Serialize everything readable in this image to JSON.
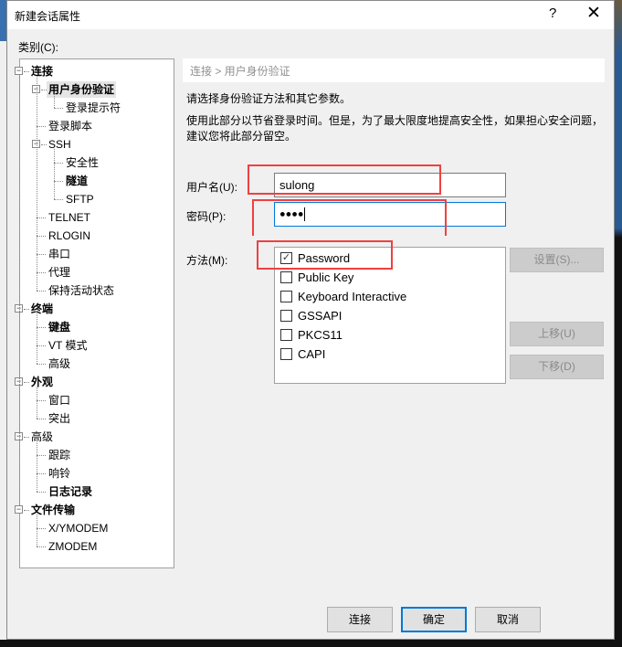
{
  "window": {
    "title": "新建会话属性",
    "help": "?",
    "close": "✕"
  },
  "category_label": "类别(C):",
  "tree": [
    {
      "label": "连接",
      "level": 0,
      "bold": true,
      "toggle": "−"
    },
    {
      "label": "用户身份验证",
      "level": 1,
      "bold": true,
      "selected": true,
      "toggle": "−"
    },
    {
      "label": "登录提示符",
      "level": 2
    },
    {
      "label": "登录脚本",
      "level": 1
    },
    {
      "label": "SSH",
      "level": 1,
      "toggle": "−"
    },
    {
      "label": "安全性",
      "level": 2
    },
    {
      "label": "隧道",
      "level": 2,
      "bold": true
    },
    {
      "label": "SFTP",
      "level": 2
    },
    {
      "label": "TELNET",
      "level": 1
    },
    {
      "label": "RLOGIN",
      "level": 1
    },
    {
      "label": "串口",
      "level": 1
    },
    {
      "label": "代理",
      "level": 1
    },
    {
      "label": "保持活动状态",
      "level": 1
    },
    {
      "label": "终端",
      "level": 0,
      "bold": true,
      "toggle": "−"
    },
    {
      "label": "键盘",
      "level": 1,
      "bold": true
    },
    {
      "label": "VT 模式",
      "level": 1
    },
    {
      "label": "高级",
      "level": 1
    },
    {
      "label": "外观",
      "level": 0,
      "bold": true,
      "toggle": "−"
    },
    {
      "label": "窗口",
      "level": 1
    },
    {
      "label": "突出",
      "level": 1
    },
    {
      "label": "高级",
      "level": 0,
      "toggle": "−"
    },
    {
      "label": "跟踪",
      "level": 1
    },
    {
      "label": "响铃",
      "level": 1
    },
    {
      "label": "日志记录",
      "level": 1,
      "bold": true
    },
    {
      "label": "文件传输",
      "level": 0,
      "bold": true,
      "toggle": "−"
    },
    {
      "label": "X/YMODEM",
      "level": 1
    },
    {
      "label": "ZMODEM",
      "level": 1
    }
  ],
  "breadcrumb": "连接 > 用户身份验证",
  "desc1": "请选择身份验证方法和其它参数。",
  "desc2": "使用此部分以节省登录时间。但是，为了最大限度地提高安全性，如果担心安全问题，",
  "desc3": "建议您将此部分留空。",
  "username": {
    "label": "用户名(U):",
    "value": "sulong"
  },
  "password": {
    "label": "密码(P):",
    "value": "●●●●"
  },
  "method": {
    "label": "方法(M):",
    "options": [
      {
        "label": "Password",
        "checked": true
      },
      {
        "label": "Public Key",
        "checked": false
      },
      {
        "label": "Keyboard Interactive",
        "checked": false
      },
      {
        "label": "GSSAPI",
        "checked": false
      },
      {
        "label": "PKCS11",
        "checked": false
      },
      {
        "label": "CAPI",
        "checked": false
      }
    ]
  },
  "buttons": {
    "settings": "设置(S)...",
    "up": "上移(U)",
    "down": "下移(D)",
    "connect": "连接",
    "ok": "确定",
    "cancel": "取消"
  },
  "colors": {
    "accent": "#0078d7",
    "highlight": "#f04040"
  }
}
